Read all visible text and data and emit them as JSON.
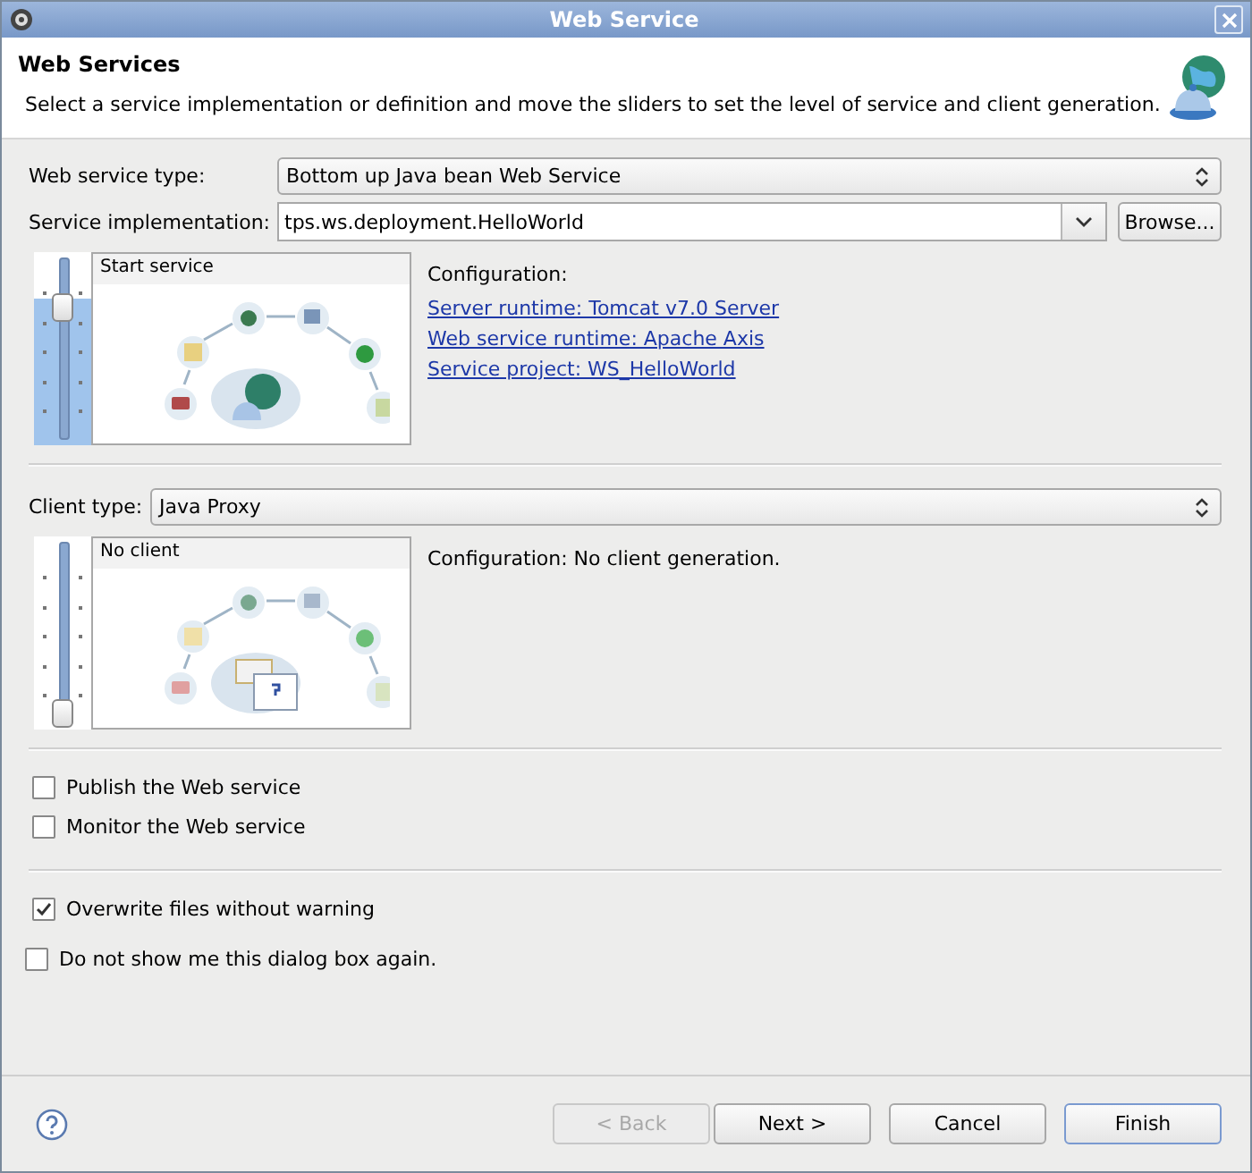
{
  "window": {
    "title": "Web Service"
  },
  "banner": {
    "title": "Web Services",
    "description": "Select a service implementation or definition and move the sliders to set the level of service and client generation."
  },
  "service_type": {
    "label": "Web service type:",
    "value": "Bottom up Java bean Web Service"
  },
  "service_implementation": {
    "label": "Service implementation:",
    "value": "tps.ws.deployment.HelloWorld",
    "browse_button": "Browse..."
  },
  "service_slider": {
    "level": 0.76,
    "caption": "Start service"
  },
  "service_configuration": {
    "heading": "Configuration:",
    "links": [
      "Server runtime: Tomcat v7.0 Server",
      "Web service runtime: Apache Axis",
      "Service project: WS_HelloWorld"
    ]
  },
  "client_type": {
    "label": "Client type:",
    "value": "Java Proxy"
  },
  "client_slider": {
    "level": 0,
    "caption": "No client"
  },
  "client_configuration": {
    "text": "Configuration: No client generation."
  },
  "options": [
    {
      "label": "Publish the Web service",
      "checked": false
    },
    {
      "label": "Monitor the Web service",
      "checked": false
    }
  ],
  "overwrite": {
    "label": "Overwrite files without warning",
    "checked": true
  },
  "dont_show": {
    "label": "Do not show me this dialog box again.",
    "checked": false
  },
  "buttons": [
    {
      "label": "< Back",
      "disabled": true,
      "default": false
    },
    {
      "label": "Next >",
      "disabled": false,
      "default": false
    },
    {
      "label": "Cancel",
      "disabled": false,
      "default": false
    },
    {
      "label": "Finish",
      "disabled": false,
      "default": true
    }
  ]
}
